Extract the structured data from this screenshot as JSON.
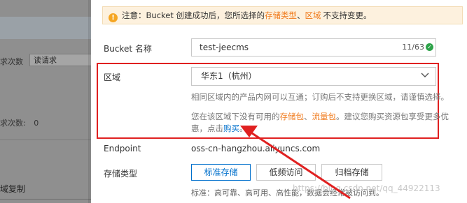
{
  "background": {
    "requests_label": "求次数",
    "requests_select": "读请求",
    "requests_count_label": "求次数:",
    "requests_count_value": "0",
    "replication_section": "域复制"
  },
  "notice": {
    "prefix": "注意：Bucket 创建成功后，您所选择的",
    "storage_type": "存储类型",
    "sep": "、",
    "region": "区域",
    "suffix": "不支持变更。"
  },
  "bucket_name": {
    "label": "Bucket 名称",
    "value": "test-jeecms",
    "count": "11/63"
  },
  "region": {
    "label": "区域",
    "selected": "华东1（杭州）",
    "hint1": "相同区域内的产品内网可以互通；订购后不支持更换区域，请谨慎选择。",
    "hint2_prefix": "您在该区域下没有可用的",
    "storage_pack": "存储包",
    "sep": "、",
    "traffic_pack": "流量包",
    "hint2_suffix": "。建议您购买资源包享受更多优",
    "hint3_prefix": "惠，点击",
    "buy_link": "购买",
    "hint3_suffix": "。"
  },
  "endpoint": {
    "label": "Endpoint",
    "value": "oss-cn-hangzhou.aliyuncs.com"
  },
  "storage_type": {
    "label": "存储类型",
    "options": [
      "标准存储",
      "低频访问",
      "归档存储"
    ],
    "selected_index": 0,
    "description": "标准：高可靠、高可用、高性能，数据会经常被访问到。"
  },
  "watermark": "https://blog.csdn.net/qq_44922113",
  "colors": {
    "accent": "#0070cc",
    "highlight": "#f07b1d",
    "annotation_red": "#e02020",
    "notice_bg": "#fdf1de"
  }
}
